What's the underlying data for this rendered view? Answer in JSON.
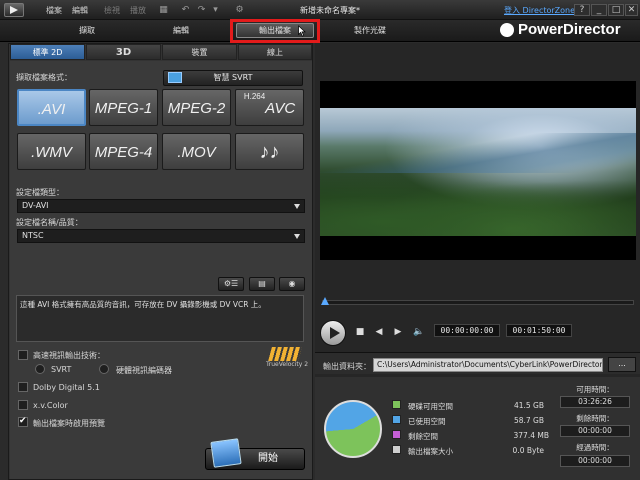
{
  "titlebar": {
    "menus": [
      "檔案",
      "編輯",
      "檢視",
      "播放",
      "外掛程式"
    ],
    "project_title": "新增未命名專案*",
    "login": "登入 DirectorZone",
    "window_buttons": [
      "?",
      "_",
      "□",
      "✕"
    ]
  },
  "modes": {
    "capture": "擷取",
    "edit": "編輯",
    "produce": "輸出檔案",
    "disc": "製作光碟"
  },
  "brand": "PowerDirector",
  "subtabs": [
    "標準 2D",
    "3D",
    "裝置",
    "線上"
  ],
  "format_section": {
    "label": "擷取檔案格式：",
    "svrt_button": "智慧 SVRT",
    "formats": [
      ".AVI",
      "MPEG-1",
      "MPEG-2",
      "AVC",
      ".WMV",
      "MPEG-4",
      ".MOV",
      "♪♪"
    ],
    "h264_prefix": "H.264"
  },
  "profile_type": {
    "label": "設定檔類型：",
    "value": "DV-AVI"
  },
  "profile_quality": {
    "label": "設定檔名稱/品質：",
    "value": "NTSC"
  },
  "description": "這種 AVI 格式擁有高品質的音訊，可存放在 DV 攝錄影機或 DV VCR 上。",
  "options": {
    "fast_render_label": "高速視訊輸出技術：",
    "svrt_radio": "SVRT",
    "hw_encoder_radio": "硬體視訊編碼器",
    "dolby": "Dolby Digital 5.1",
    "xvcolor": "x.v.Color",
    "preview": "輸出檔案時啟用預覽",
    "truevelocity_logo": "TrueVelocity 2"
  },
  "start_button": "開始",
  "playback": {
    "current_time": "00:00:00:00",
    "total_time": "00:01:50:00"
  },
  "output": {
    "label": "輸出資料夾：",
    "path": "C:\\Users\\Administrator\\Documents\\CyberLink\\PowerDirector\\10",
    "browse": "..."
  },
  "disk": {
    "items": [
      {
        "label": "硬碟可用空間",
        "value": "41.5 GB",
        "color": "#7dc35b"
      },
      {
        "label": "已使用空間",
        "value": "58.7 GB",
        "color": "#52a5e6"
      },
      {
        "label": "剩餘空間",
        "value": "377.4 MB",
        "color": "#c55fd6"
      },
      {
        "label": "輸出檔案大小",
        "value": "0.0 Byte",
        "color": "#cfcfcf"
      }
    ],
    "times": [
      {
        "label": "可用時間：",
        "value": "03:26:26"
      },
      {
        "label": "剩餘時間：",
        "value": "00:00:00"
      },
      {
        "label": "經過時間：",
        "value": "00:00:00"
      }
    ]
  },
  "colors": {
    "accent": "#4b86c4",
    "highlight_box": "#e31b1b"
  }
}
